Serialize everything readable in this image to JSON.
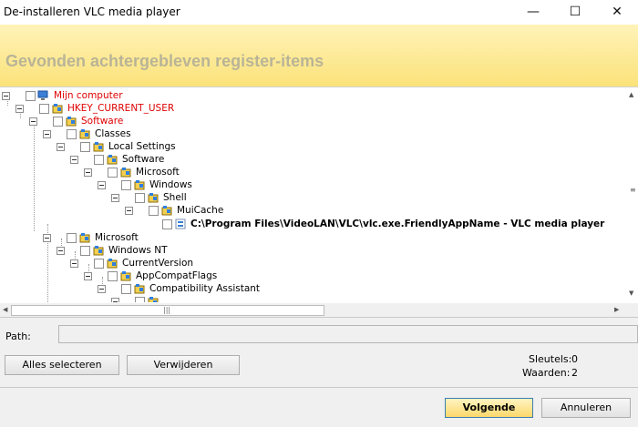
{
  "window": {
    "title": "De-installeren VLC media player",
    "controls": {
      "minimize": "—",
      "maximize": "☐",
      "close": "✕"
    }
  },
  "banner": {
    "title": "Gevonden achtergebleven register-items"
  },
  "tree": {
    "nodes": [
      {
        "label": "Mijn computer",
        "style": "red",
        "icon": "computer-icon"
      },
      {
        "label": "HKEY_CURRENT_USER",
        "style": "red",
        "icon": "registry-folder-icon"
      },
      {
        "label": "Software",
        "style": "red",
        "icon": "registry-folder-icon"
      },
      {
        "label": "Classes",
        "style": "normal",
        "icon": "registry-folder-icon"
      },
      {
        "label": "Local Settings",
        "style": "normal",
        "icon": "registry-folder-icon"
      },
      {
        "label": "Software",
        "style": "normal",
        "icon": "registry-folder-icon"
      },
      {
        "label": "Microsoft",
        "style": "normal",
        "icon": "registry-folder-icon"
      },
      {
        "label": "Windows",
        "style": "normal",
        "icon": "registry-folder-icon"
      },
      {
        "label": "Shell",
        "style": "normal",
        "icon": "registry-folder-icon"
      },
      {
        "label": "MuiCache",
        "style": "normal",
        "icon": "registry-folder-icon"
      },
      {
        "label": "C:\\Program Files\\VideoLAN\\VLC\\vlc.exe.FriendlyAppName - VLC media player",
        "style": "bold",
        "icon": "registry-value-icon"
      },
      {
        "label": "Microsoft",
        "style": "normal",
        "icon": "registry-folder-icon"
      },
      {
        "label": "Windows NT",
        "style": "normal",
        "icon": "registry-folder-icon"
      },
      {
        "label": "CurrentVersion",
        "style": "normal",
        "icon": "registry-folder-icon"
      },
      {
        "label": "AppCompatFlags",
        "style": "normal",
        "icon": "registry-folder-icon"
      },
      {
        "label": "Compatibility Assistant",
        "style": "normal",
        "icon": "registry-folder-icon"
      }
    ]
  },
  "path": {
    "label": "Path:",
    "value": ""
  },
  "buttons": {
    "select_all": "Alles selecteren",
    "remove": "Verwijderen",
    "next": "Volgende",
    "cancel": "Annuleren"
  },
  "stats": {
    "keys_label": "Sleutels:",
    "keys_value": "0",
    "values_label": "Waarden:",
    "values_value": "2"
  },
  "colors": {
    "banner": "#fbe27a",
    "red_text": "#e00000",
    "primary_border": "#3c7fb1"
  }
}
